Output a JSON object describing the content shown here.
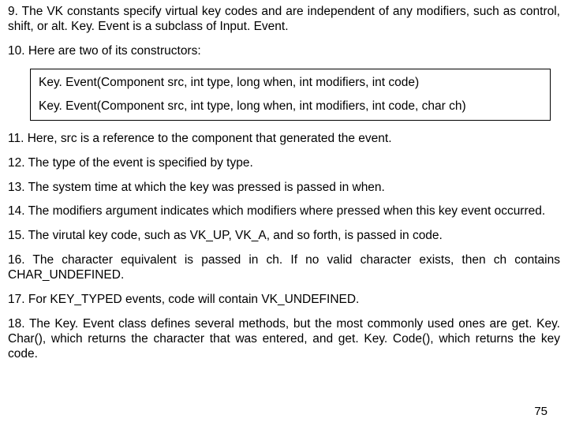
{
  "paragraphs": {
    "p9": "9. The  VK constants specify virtual key codes and are independent of any modifiers, such as control, shift, or alt. Key. Event is a subclass of Input. Event.",
    "p10": "10. Here are two of its constructors:",
    "code1": "Key. Event(Component src, int type, long when, int modifiers, int code)",
    "code2": "Key. Event(Component src, int type, long when, int modifiers, int code, char ch)",
    "p11": "11. Here, src is a reference to the component that generated the event.",
    "p12": "12. The type of the event is specified by type.",
    "p13": "13. The system time at which the key was pressed is passed in when.",
    "p14": "14. The modifiers argument indicates which modifiers where pressed when this key event occurred.",
    "p15": "15. The virutal key code, such as VK_UP, VK_A, and so forth, is passed in code.",
    "p16": "16. The character equivalent is passed in ch. If no valid character exists, then ch contains CHAR_UNDEFINED.",
    "p17": "17. For KEY_TYPED events, code will contain VK_UNDEFINED.",
    "p18": "18. The Key. Event class defines several methods, but the most commonly used ones are get. Key. Char(), which returns the character that was entered, and get. Key. Code(), which returns the key code."
  },
  "page_number": "75"
}
